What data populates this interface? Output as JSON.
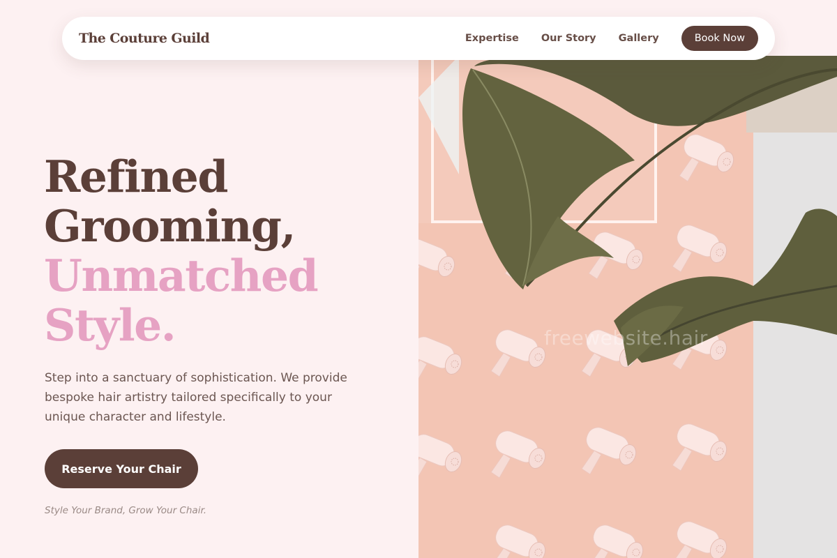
{
  "header": {
    "brand": "The Couture Guild",
    "nav": [
      "Expertise",
      "Our Story",
      "Gallery"
    ],
    "book_label": "Book Now"
  },
  "hero": {
    "headline_dark": [
      "Refined",
      "Grooming,"
    ],
    "headline_accent": [
      "Unmatched",
      "Style."
    ],
    "lead": "Step into a sanctuary of sophistication. We provide bespoke hair artistry tailored specifically to your unique character and lifestyle.",
    "cta_label": "Reserve Your Chair",
    "tagline": "Style Your Brand, Grow Your Chair.",
    "image_watermark": "freewebsite.hair"
  },
  "colors": {
    "background": "#fdf1f2",
    "primary": "#5b3f38",
    "accent": "#e6a2c3",
    "image_wall": "#f3c6b5"
  },
  "icons": [
    "hair-dryer-icon",
    "banana-leaf-icon"
  ]
}
